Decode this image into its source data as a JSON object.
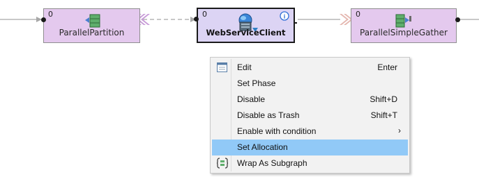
{
  "nodes": {
    "partition": {
      "count": "0",
      "label": "ParallelPartition"
    },
    "client": {
      "count": "0",
      "label": "WebServiceClient",
      "info": "i"
    },
    "gather": {
      "count": "0",
      "label": "ParallelSimpleGather"
    }
  },
  "context_menu": {
    "items": [
      {
        "label": "Edit",
        "shortcut": "Enter",
        "icon": "edit-icon"
      },
      {
        "label": "Set Phase",
        "shortcut": ""
      },
      {
        "label": "Disable",
        "shortcut": "Shift+D"
      },
      {
        "label": "Disable as Trash",
        "shortcut": "Shift+T"
      },
      {
        "label": "Enable with condition",
        "shortcut": "",
        "submenu": "›"
      },
      {
        "label": "Set Allocation",
        "shortcut": "",
        "highlighted": true
      },
      {
        "label": "Wrap As Subgraph",
        "shortcut": "",
        "icon": "subgraph-icon"
      }
    ]
  },
  "colors": {
    "component_fill": "#e4c9ee",
    "selected_fill": "#dcd4f4",
    "menu_highlight": "#91c9f7",
    "edge": "#a8a8a8",
    "info_badge": "#2f6fd6"
  }
}
